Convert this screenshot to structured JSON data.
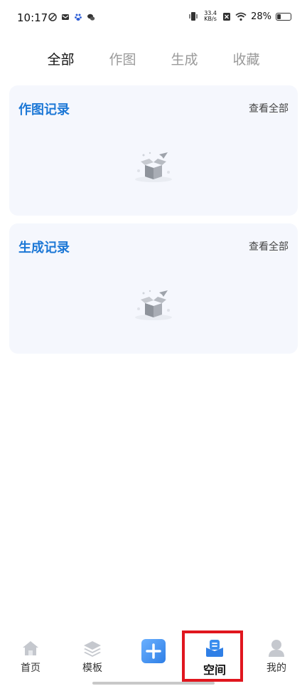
{
  "status": {
    "time": "10:17",
    "net_speed_value": "33.4",
    "net_speed_unit": "KB/s",
    "battery": "28%",
    "battery_level": 0.28
  },
  "tabs": [
    {
      "label": "全部",
      "active": true
    },
    {
      "label": "作图",
      "active": false
    },
    {
      "label": "生成",
      "active": false
    },
    {
      "label": "收藏",
      "active": false
    }
  ],
  "cards": [
    {
      "title": "作图记录",
      "link": "查看全部"
    },
    {
      "title": "生成记录",
      "link": "查看全部"
    }
  ],
  "nav": [
    {
      "label": "首页",
      "icon": "home-icon"
    },
    {
      "label": "模板",
      "icon": "layers-icon"
    },
    {
      "label": "",
      "icon": "plus-icon"
    },
    {
      "label": "空间",
      "icon": "space-icon",
      "active": true
    },
    {
      "label": "我的",
      "icon": "user-icon"
    }
  ],
  "colors": {
    "accent": "#1d78d6",
    "card_bg": "#f5f7fd",
    "highlight": "#e0161e"
  }
}
